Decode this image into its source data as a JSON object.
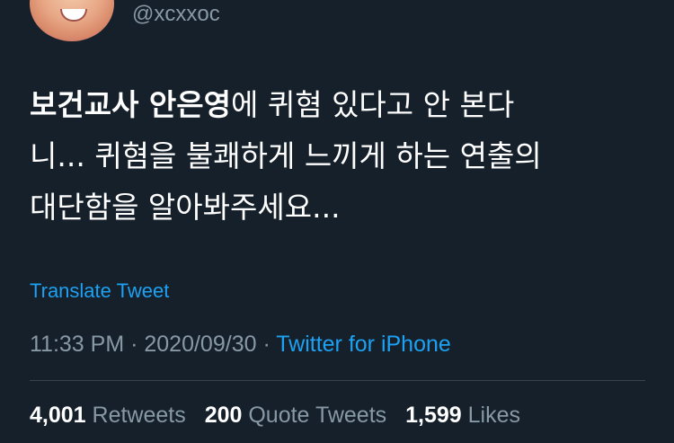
{
  "user": {
    "handle": "@xcxxoc"
  },
  "tweet": {
    "bold_part": "보건교사 안은영",
    "line1_rest": "에 퀴혐 있다고 안 본다",
    "line2": "니... 퀴혐을 불쾌하게 느끼게 하는 연출의",
    "line3": "대단함을 알아봐주세요...",
    "translate_label": "Translate Tweet"
  },
  "meta": {
    "time": "11:33 PM",
    "separator1": " · ",
    "date": "2020/09/30",
    "separator2": " · ",
    "source": "Twitter for iPhone"
  },
  "stats": {
    "retweets_count": "4,001",
    "retweets_label": "Retweets",
    "quotes_count": "200",
    "quotes_label": "Quote Tweets",
    "likes_count": "1,599",
    "likes_label": "Likes"
  },
  "colors": {
    "background": "#15202b",
    "text": "#ffffff",
    "secondary": "#8899a6",
    "accent": "#1da1f2",
    "divider": "#38444d"
  }
}
